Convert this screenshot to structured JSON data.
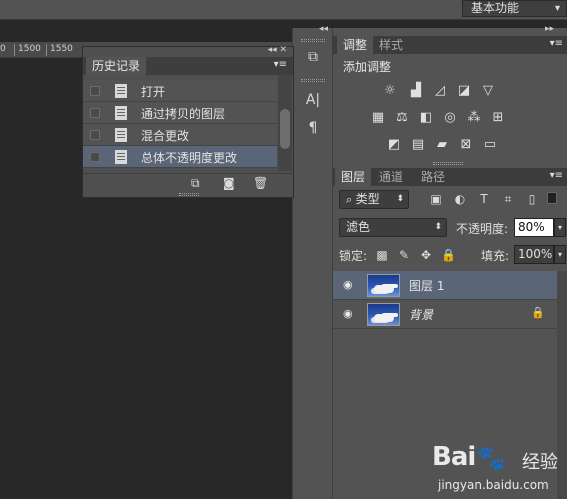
{
  "topbar": {
    "workspace": "基本功能"
  },
  "ruler": {
    "labels": [
      "0",
      "1500",
      "1550"
    ]
  },
  "history": {
    "tab": "历史记录",
    "items": [
      {
        "label": "打开",
        "selected": false
      },
      {
        "label": "通过拷贝的图层",
        "selected": false
      },
      {
        "label": "混合更改",
        "selected": false
      },
      {
        "label": "总体不透明度更改",
        "selected": true
      }
    ]
  },
  "adjustments": {
    "tabs": [
      "调整",
      "样式"
    ],
    "title": "添加调整"
  },
  "layers": {
    "tabs": [
      "图层",
      "通道",
      "路径"
    ],
    "filter_kind": "类型",
    "blend_mode": "滤色",
    "opacity_label": "不透明度:",
    "opacity_value": "80%",
    "lock_label": "锁定:",
    "fill_label": "填充:",
    "fill_value": "100%",
    "items": [
      {
        "name": "图层 1",
        "selected": true,
        "locked": false
      },
      {
        "name": "背景",
        "selected": false,
        "locked": true
      }
    ]
  },
  "watermark": {
    "logo": "Bai",
    "logo2": "经验",
    "url": "jingyan.baidu.com"
  }
}
